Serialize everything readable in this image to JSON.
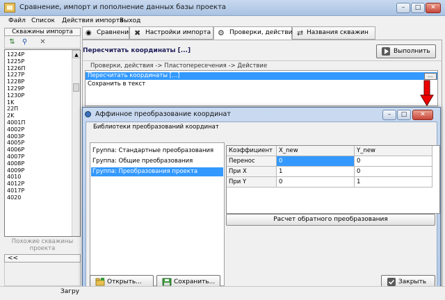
{
  "window": {
    "title": "Сравнение, импорт и пополнение данных базы проекта",
    "controls": {
      "minimize": "–",
      "maximize": "□",
      "close": "✕"
    }
  },
  "menu": [
    "Файл",
    "Список",
    "Действия импорта",
    "Выход"
  ],
  "left_panel": {
    "header": "Скважины импорта",
    "wells": [
      "1224Р",
      "1225Р",
      "1226П",
      "1227Р",
      "1228Р",
      "1229Р",
      "1230Р",
      "1K",
      "22П",
      "2K",
      "4001П",
      "4002Р",
      "4003Р",
      "4005Р",
      "4006Р",
      "4007Р",
      "4008Р",
      "4009Р",
      "4010",
      "4012Р",
      "4017Р",
      "4020"
    ],
    "similar_label": "Похожие скважины проекта",
    "prev_button": "<<"
  },
  "tabs": [
    "Сравнение",
    "Настройки импорта",
    "Проверки, действия",
    "Названия скважин"
  ],
  "main": {
    "title": "Пересчитать координаты [...]",
    "execute_button": "Выполнить",
    "actions_caption": "Проверки, действия -> Пластопересечения -> Действие",
    "actions": [
      "Пересчитать координаты [...]",
      "Сохранить в текст"
    ],
    "ellipsis": "..."
  },
  "dialog": {
    "title": "Аффинное преобразование координат",
    "library_caption": "Библиотеки преобразований координат",
    "groups": [
      "Группа: Стандартные преобразования",
      "Группа: Общие преобразования",
      "Группа: Преобразования проекта"
    ],
    "grid": {
      "headers": [
        "Коэффициент",
        "X_new",
        "Y_new"
      ],
      "rows": [
        {
          "label": "Перенос",
          "x": "0",
          "y": "0"
        },
        {
          "label": "При X",
          "x": "1",
          "y": "0"
        },
        {
          "label": "При Y",
          "x": "0",
          "y": "1"
        }
      ]
    },
    "inverse_button": "Расчет обратного преобразования",
    "open_button": "Открыть...",
    "save_button": "Сохранить...",
    "close_button": "Закрыть"
  },
  "status": {
    "text": "Загру"
  }
}
